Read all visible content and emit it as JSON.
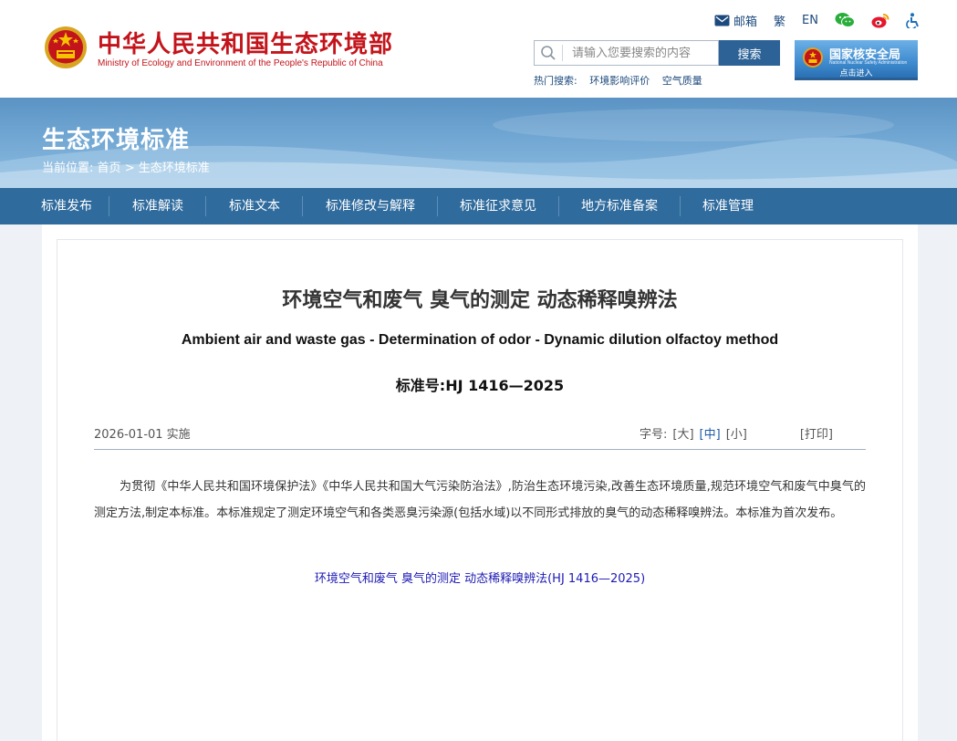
{
  "header": {
    "logo_cn": "中华人民共和国生态环境部",
    "logo_en": "Ministry of Ecology and Environment of the People's Republic of China",
    "toplinks": {
      "mail": "邮箱",
      "traditional": "繁",
      "english": "EN"
    },
    "search": {
      "placeholder": "请输入您要搜索的内容",
      "button": "搜索"
    },
    "hot": {
      "label": "热门搜索:",
      "items": [
        "环境影响评价",
        "空气质量"
      ]
    },
    "nnsa": {
      "name_cn": "国家核安全局",
      "name_en": "National Nuclear Safety Administration",
      "enter": "点击进入"
    }
  },
  "banner": {
    "title": "生态环境标准",
    "breadcrumb": {
      "prefix": "当前位置:",
      "home": "首页",
      "separator": " > ",
      "current": "生态环境标准"
    }
  },
  "nav": {
    "items": [
      "标准发布",
      "标准解读",
      "标准文本",
      "标准修改与解释",
      "标准征求意见",
      "地方标准备案",
      "标准管理"
    ]
  },
  "article": {
    "title": "环境空气和废气 臭气的测定 动态稀释嗅辨法",
    "title_en": "Ambient air and waste gas - Determination of odor - Dynamic dilution olfactoy method",
    "standard_no": "标准号:HJ 1416—2025",
    "date": "2026-01-01 实施",
    "font_label": "字号:",
    "font_large": "[大]",
    "font_medium": "[中]",
    "font_small": "[小]",
    "print": "[打印]",
    "body": "为贯彻《中华人民共和国环境保护法》《中华人民共和国大气污染防治法》,防治生态环境污染,改善生态环境质量,规范环境空气和废气中臭气的测定方法,制定本标准。本标准规定了测定环境空气和各类恶臭污染源(包括水域)以不同形式排放的臭气的动态稀释嗅辨法。本标准为首次发布。",
    "attachment": "环境空气和废气 臭气的测定 动态稀释嗅辨法(HJ 1416—2025)"
  },
  "colors": {
    "brand_red": "#c3141b",
    "nav_blue": "#2f6b9d",
    "link_blue": "#1d4a7d"
  }
}
